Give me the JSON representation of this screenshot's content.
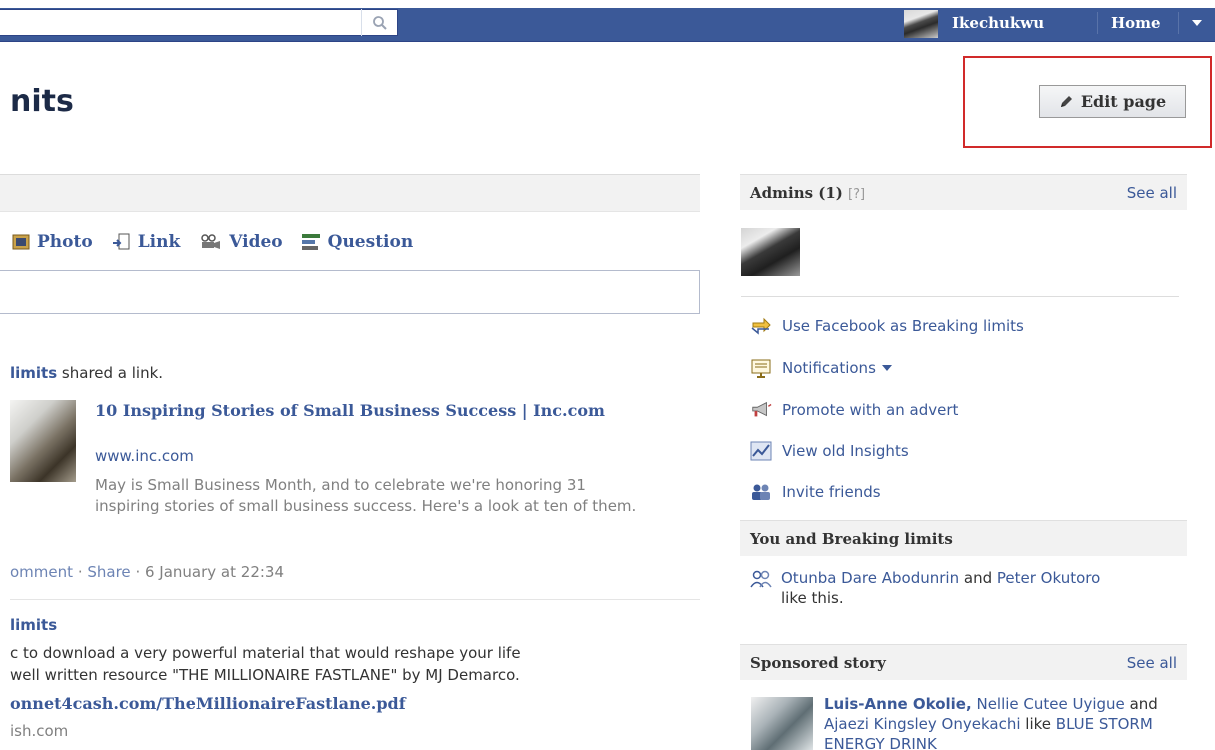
{
  "topbar": {
    "user_name": "Ikechukwu",
    "home_label": "Home"
  },
  "page": {
    "title_fragment": "nits",
    "edit_button": "Edit page"
  },
  "composer": {
    "tabs": [
      {
        "label": "Photo",
        "icon": "photo-icon"
      },
      {
        "label": "Link",
        "icon": "link-icon"
      },
      {
        "label": "Video",
        "icon": "video-icon"
      },
      {
        "label": "Question",
        "icon": "question-icon"
      }
    ]
  },
  "feed": {
    "story1": {
      "actor": "limits",
      "action": " shared a link.",
      "title": "10 Inspiring Stories of Small Business Success | Inc.com",
      "url": "www.inc.com",
      "description": "May is Small Business Month, and to celebrate we're honoring 31 inspiring stories of small business success. Here's a look at ten of them.",
      "comment": "omment",
      "share": "Share",
      "timestamp": "6 January at 22:34"
    },
    "story2": {
      "actor": "limits",
      "line1": "c to download a very powerful material that would reshape your life",
      "line2": "well written resource \"THE MILLIONAIRE FASTLANE\" by MJ Demarco.",
      "link": "onnet4cash.com/TheMillionaireFastlane.pdf",
      "domain": "ish.com"
    }
  },
  "sidebar": {
    "admins": {
      "title": "Admins (1)",
      "help": "[?]",
      "see_all": "See all"
    },
    "actions": [
      {
        "label": "Use Facebook as Breaking limits",
        "icon": "switch-user-icon",
        "dropdown": false
      },
      {
        "label": "Notifications",
        "icon": "notifications-icon",
        "dropdown": true
      },
      {
        "label": "Promote with an advert",
        "icon": "megaphone-icon",
        "dropdown": false
      },
      {
        "label": "View old Insights",
        "icon": "insights-chart-icon",
        "dropdown": false
      },
      {
        "label": "Invite friends",
        "icon": "invite-friends-icon",
        "dropdown": false
      }
    ],
    "you_and": {
      "title": "You and Breaking limits",
      "friend1": "Otunba Dare Abodunrin",
      "and": " and ",
      "friend2": "Peter Okutoro",
      "suffix": "like this."
    },
    "sponsored": {
      "title": "Sponsored story",
      "see_all": "See all",
      "person1": "Luis-Anne Okolie,",
      "person2": "Nellie Cutee Uyigue",
      "and": " and ",
      "person3": "Ajaezi Kingsley Onyekachi",
      "like": " like ",
      "page": "BLUE STORM ENERGY DRINK"
    }
  },
  "colors": {
    "brand_blue": "#3b5998",
    "highlight_red": "#d12a2a"
  }
}
